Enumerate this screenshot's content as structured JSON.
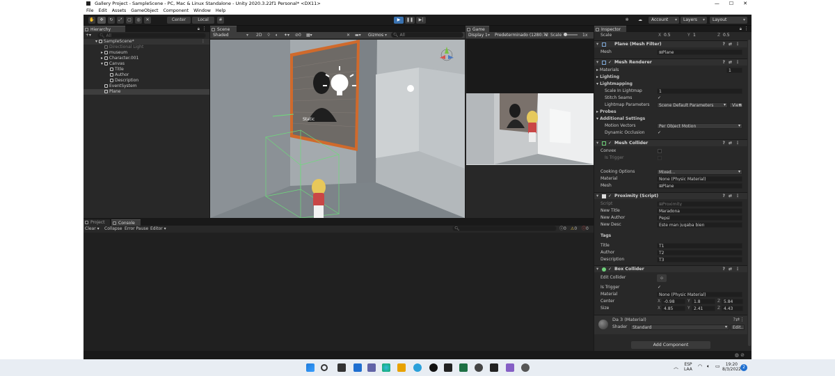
{
  "title": "Gallery Project - SampleScene - PC, Mac & Linux Standalone - Unity 2020.3.22f1 Personal* <DX11>",
  "menu": [
    "File",
    "Edit",
    "Assets",
    "GameObject",
    "Component",
    "Window",
    "Help"
  ],
  "toolbar": {
    "center": "Center",
    "local": "Local",
    "account": "Account",
    "layers": "Layers",
    "layout": "Layout"
  },
  "hierarchy": {
    "tab": "Hierarchy",
    "search_placeholder": "All",
    "items": [
      {
        "label": "SampleScene*",
        "indent": 0
      },
      {
        "label": "Directional Light",
        "indent": 2
      },
      {
        "label": "museum",
        "indent": 1
      },
      {
        "label": "Character.001",
        "indent": 1
      },
      {
        "label": "Canvas",
        "indent": 1
      },
      {
        "label": "Title",
        "indent": 2
      },
      {
        "label": "Author",
        "indent": 2
      },
      {
        "label": "Description",
        "indent": 2
      },
      {
        "label": "EventSystem",
        "indent": 1
      },
      {
        "label": "Plane",
        "indent": 1
      }
    ]
  },
  "scene": {
    "tab": "Scene",
    "shading": "Shaded",
    "mode2d": "2D",
    "gizmos": "Gizmos",
    "search": "All",
    "static_label": "Static"
  },
  "game": {
    "tab": "Game",
    "display": "Display 1",
    "resolution": "Predeterminado (1280:72",
    "scale_label": "Scale",
    "scale_value": "1x"
  },
  "bottom": {
    "tab_project": "Project",
    "tab_console": "Console",
    "clear": "Clear",
    "collapse": "Collapse",
    "error_pause": "Error Pause",
    "editor": "Editor",
    "log_count": "0",
    "warn_count": "0",
    "error_count": "0"
  },
  "inspector": {
    "tab": "Inspector",
    "scale": {
      "label": "Scale",
      "x": "0.5",
      "y": "1",
      "z": "0.5"
    },
    "mesh_filter": {
      "name": "Plane (Mesh Filter)",
      "mesh_label": "Mesh",
      "mesh_value": "Plane"
    },
    "mesh_renderer": {
      "name": "Mesh Renderer",
      "materials": "Materials",
      "materials_count": "1",
      "lighting": "Lighting",
      "lightmapping": "Lightmapping",
      "scale_in_lightmap": "Scale In Lightmap",
      "scale_in_lightmap_value": "1",
      "stitch_seams": "Stitch Seams",
      "lightmap_parameters": "Lightmap Parameters",
      "lightmap_parameters_value": "Scene Default Parameters",
      "view_btn": "View",
      "probes": "Probes",
      "additional_settings": "Additional Settings",
      "motion_vectors": "Motion Vectors",
      "motion_vectors_value": "Per Object Motion",
      "dynamic_occlusion": "Dynamic Occlusion"
    },
    "mesh_collider": {
      "name": "Mesh Collider",
      "convex": "Convex",
      "is_trigger": "Is Trigger",
      "cooking_options": "Cooking Options",
      "cooking_options_value": "Mixed...",
      "material": "Material",
      "material_value": "None (Physic Material)",
      "mesh": "Mesh",
      "mesh_value": "Plane"
    },
    "proximity": {
      "name": "Proximity (Script)",
      "script_label": "Script",
      "script_value": "Proximity",
      "new_title": "New Title",
      "new_title_value": "Maradona",
      "new_author": "New Author",
      "new_author_value": "Pepsi",
      "new_desc": "New Desc",
      "new_desc_value": "Este man jugaba bien",
      "tags": "Tags",
      "title": "Title",
      "title_value": "T1",
      "author": "Author",
      "author_value": "T2",
      "description": "Description",
      "description_value": "T3"
    },
    "box_collider": {
      "name": "Box Collider",
      "edit_collider": "Edit Collider",
      "is_trigger": "Is Trigger",
      "material": "Material",
      "material_value": "None (Physic Material)",
      "center": "Center",
      "center_x": "-0.98",
      "center_y": "1.8",
      "center_z": "5.84",
      "size": "Size",
      "size_x": "4.85",
      "size_y": "2.41",
      "size_z": "4.43"
    },
    "material_asset": {
      "name": "Da 3 (Material)",
      "shader_label": "Shader",
      "shader_value": "Standard",
      "edit_btn": "Edit..."
    },
    "add_component": "Add Component"
  },
  "taskbar": {
    "lang": "ESP",
    "lang2": "LAA",
    "time": "19:20",
    "date": "8/3/2022",
    "notif": "2"
  },
  "colors": {
    "accent": "#4a90d9",
    "play_active": "#3a72b0",
    "selection": "#2c5d87"
  }
}
